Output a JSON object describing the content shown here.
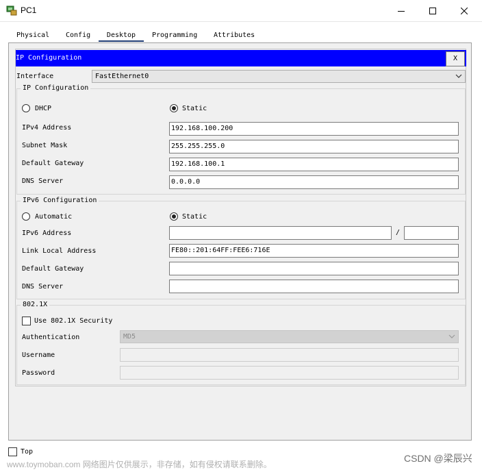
{
  "window": {
    "title": "PC1",
    "controls": [
      "minimize-icon",
      "maximize-icon",
      "close-icon"
    ]
  },
  "tabs": [
    {
      "label": "Physical",
      "active": false
    },
    {
      "label": "Config",
      "active": false
    },
    {
      "label": "Desktop",
      "active": true
    },
    {
      "label": "Programming",
      "active": false
    },
    {
      "label": "Attributes",
      "active": false
    }
  ],
  "ip_config": {
    "title": "IP Configuration",
    "close_label": "X",
    "interface_label": "Interface",
    "interface_value": "FastEthernet0"
  },
  "ipv4": {
    "group_title": "IP Configuration",
    "dhcp_label": "DHCP",
    "static_label": "Static",
    "mode": "Static",
    "address_label": "IPv4 Address",
    "address_value": "192.168.100.200",
    "mask_label": "Subnet Mask",
    "mask_value": "255.255.255.0",
    "gateway_label": "Default Gateway",
    "gateway_value": "192.168.100.1",
    "dns_label": "DNS Server",
    "dns_value": "0.0.0.0"
  },
  "ipv6": {
    "group_title": "IPv6 Configuration",
    "automatic_label": "Automatic",
    "static_label": "Static",
    "mode": "Static",
    "address_label": "IPv6 Address",
    "address_value": "",
    "prefix_separator": "/",
    "prefix_value": "",
    "link_local_label": "Link Local Address",
    "link_local_value": "FE80::201:64FF:FEE6:716E",
    "gateway_label": "Default Gateway",
    "gateway_value": "",
    "dns_label": "DNS Server",
    "dns_value": ""
  },
  "dot1x": {
    "group_title": "802.1X",
    "use_security_label": "Use 802.1X Security",
    "use_security_checked": false,
    "auth_label": "Authentication",
    "auth_value": "MD5",
    "username_label": "Username",
    "username_value": "",
    "password_label": "Password",
    "password_value": ""
  },
  "footer": {
    "top_label": "Top",
    "top_checked": false
  },
  "overlay": {
    "watermark": "www.toymoban.com 网络图片仅供展示，非存储，如有侵权请联系删除。",
    "credit": "CSDN @梁辰兴"
  },
  "colors": {
    "header_bar": "#0000ff",
    "frame_bg": "#f0f0f0",
    "active_tab_underline": "#1f3b73"
  }
}
